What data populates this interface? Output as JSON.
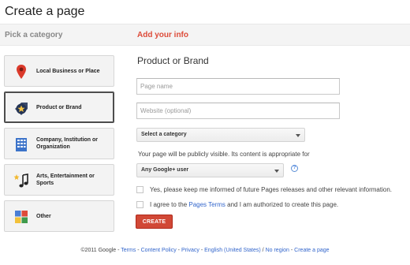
{
  "header": {
    "title": "Create a page"
  },
  "steps": {
    "pick": "Pick a category",
    "add": "Add your info"
  },
  "categories": [
    {
      "label": "Local Business or Place",
      "icon": "map-pin-icon"
    },
    {
      "label": "Product or Brand",
      "icon": "star-tag-icon",
      "selected": true
    },
    {
      "label": "Company, Institution or Organization",
      "icon": "building-icon"
    },
    {
      "label": "Arts, Entertainment or Sports",
      "icon": "music-note-icon"
    },
    {
      "label": "Other",
      "icon": "tiles-icon"
    }
  ],
  "form": {
    "title": "Product or Brand",
    "page_name_placeholder": "Page name",
    "website_placeholder": "Website (optional)",
    "category_select": "Select a category",
    "visibility_text": "Your page will be publicly visible. Its content is appropriate for",
    "audience_select": "Any Google+ user",
    "help": "?",
    "keep_informed": "Yes, please keep me informed of future Pages releases and other relevant information.",
    "agree_prefix": "I agree to the ",
    "agree_link": "Pages Terms",
    "agree_suffix": " and I am authorized to create this page.",
    "create_button": "CREATE"
  },
  "footer": {
    "copyright": "©2011 Google",
    "sep": " - ",
    "slash": " / ",
    "links": {
      "terms": "Terms",
      "content_policy": "Content Policy",
      "privacy": "Privacy",
      "language": "English (United States)",
      "region": "No region",
      "create_page": "Create a page"
    }
  },
  "colors": {
    "accent": "#dd4b39",
    "button": "#d14836",
    "link": "#3366cc"
  }
}
